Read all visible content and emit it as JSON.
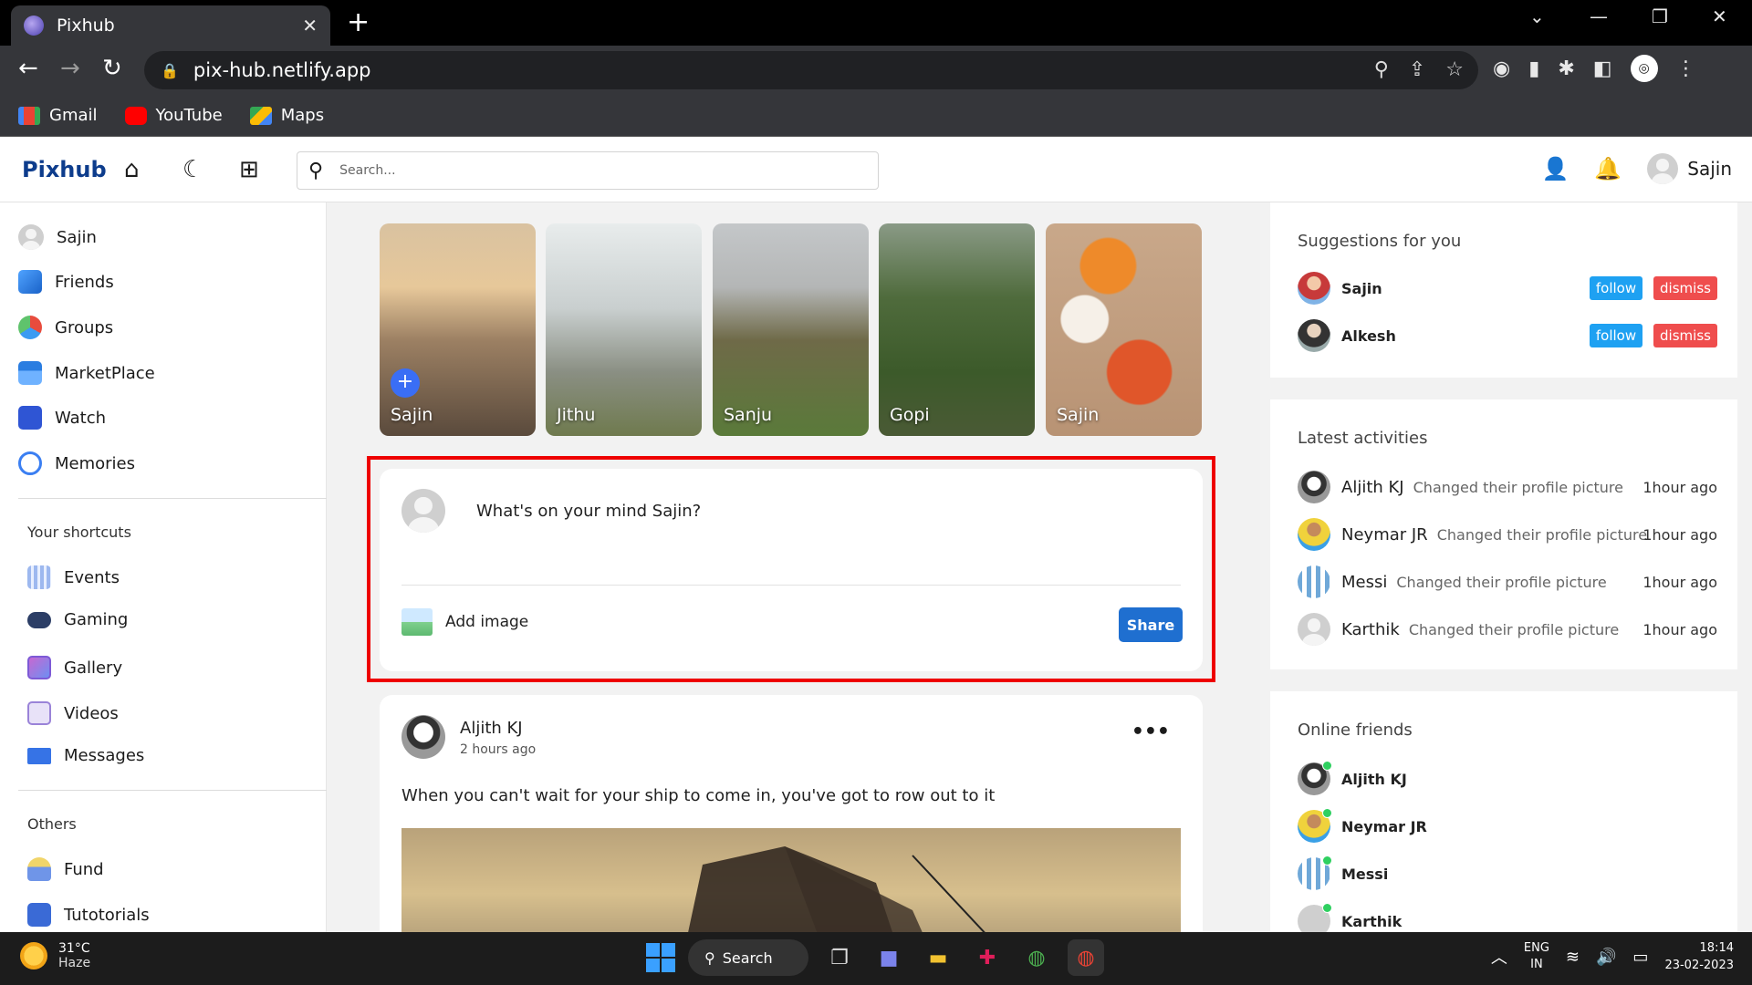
{
  "browser": {
    "tab_title": "Pixhub",
    "url": "pix-hub.netlify.app",
    "bookmarks": [
      {
        "label": "Gmail",
        "color": "#ea4335"
      },
      {
        "label": "YouTube",
        "color": "#ff0000"
      },
      {
        "label": "Maps",
        "color": "#34a853"
      }
    ]
  },
  "app": {
    "logo": "Pixhub",
    "search_placeholder": "Search...",
    "user_name": "Sajin",
    "accent": "#0d3c8c"
  },
  "sidebar": {
    "items": [
      {
        "label": "Sajin",
        "icon": "user-avatar-icon"
      },
      {
        "label": "Friends",
        "icon": "friends-icon"
      },
      {
        "label": "Groups",
        "icon": "groups-icon"
      },
      {
        "label": "MarketPlace",
        "icon": "marketplace-icon"
      },
      {
        "label": "Watch",
        "icon": "watch-icon"
      },
      {
        "label": "Memories",
        "icon": "memories-icon"
      }
    ],
    "shortcuts_title": "Your shortcuts",
    "shortcuts": [
      {
        "label": "Events",
        "icon": "events-icon"
      },
      {
        "label": "Gaming",
        "icon": "gaming-icon"
      },
      {
        "label": "Gallery",
        "icon": "gallery-icon"
      },
      {
        "label": "Videos",
        "icon": "videos-icon"
      },
      {
        "label": "Messages",
        "icon": "messages-icon"
      }
    ],
    "others_title": "Others",
    "others": [
      {
        "label": "Fund",
        "icon": "fund-icon"
      },
      {
        "label": "Tutotorials",
        "icon": "tutorials-icon"
      }
    ]
  },
  "stories": [
    {
      "name": "Sajin",
      "has_add": true
    },
    {
      "name": "Jithu"
    },
    {
      "name": "Sanju"
    },
    {
      "name": "Gopi"
    },
    {
      "name": "Sajin"
    }
  ],
  "composer": {
    "placeholder": "What's on your mind Sajin?",
    "add_image_label": "Add image",
    "share_label": "Share"
  },
  "post": {
    "author": "Aljith KJ",
    "time": "2 hours ago",
    "text": "When you can't wait for your ship to come in, you've got to row out to it"
  },
  "suggestions": {
    "title": "Suggestions for you",
    "follow_label": "follow",
    "dismiss_label": "dismiss",
    "users": [
      {
        "name": "Sajin"
      },
      {
        "name": "Alkesh"
      }
    ]
  },
  "activities": {
    "title": "Latest activities",
    "items": [
      {
        "name": "Aljith KJ",
        "desc": "Changed their profile picture",
        "time": "1hour ago"
      },
      {
        "name": "Neymar JR",
        "desc": "Changed their profile picture",
        "time": "1hour ago"
      },
      {
        "name": "Messi",
        "desc": "Changed their profile picture",
        "time": "1hour ago"
      },
      {
        "name": "Karthik",
        "desc": "Changed their profile picture",
        "time": "1hour ago"
      }
    ]
  },
  "online": {
    "title": "Online friends",
    "users": [
      {
        "name": "Aljith KJ"
      },
      {
        "name": "Neymar JR"
      },
      {
        "name": "Messi"
      },
      {
        "name": "Karthik"
      }
    ]
  },
  "taskbar": {
    "temperature": "31°C",
    "condition": "Haze",
    "search_label": "Search",
    "lang_line1": "ENG",
    "lang_line2": "IN",
    "time": "18:14",
    "date": "23-02-2023"
  }
}
